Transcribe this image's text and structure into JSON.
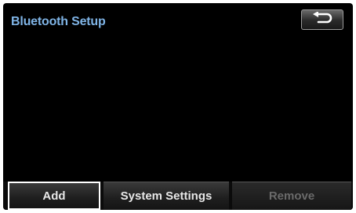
{
  "header": {
    "title": "Bluetooth Setup",
    "back_icon": "return-arrow-icon"
  },
  "bottom_bar": {
    "add_label": "Add",
    "system_settings_label": "System Settings",
    "remove_label": "Remove"
  },
  "colors": {
    "title": "#7fb4e6",
    "background": "#000000",
    "selected_border": "#ffffff",
    "disabled_text": "#6a6a6a"
  }
}
